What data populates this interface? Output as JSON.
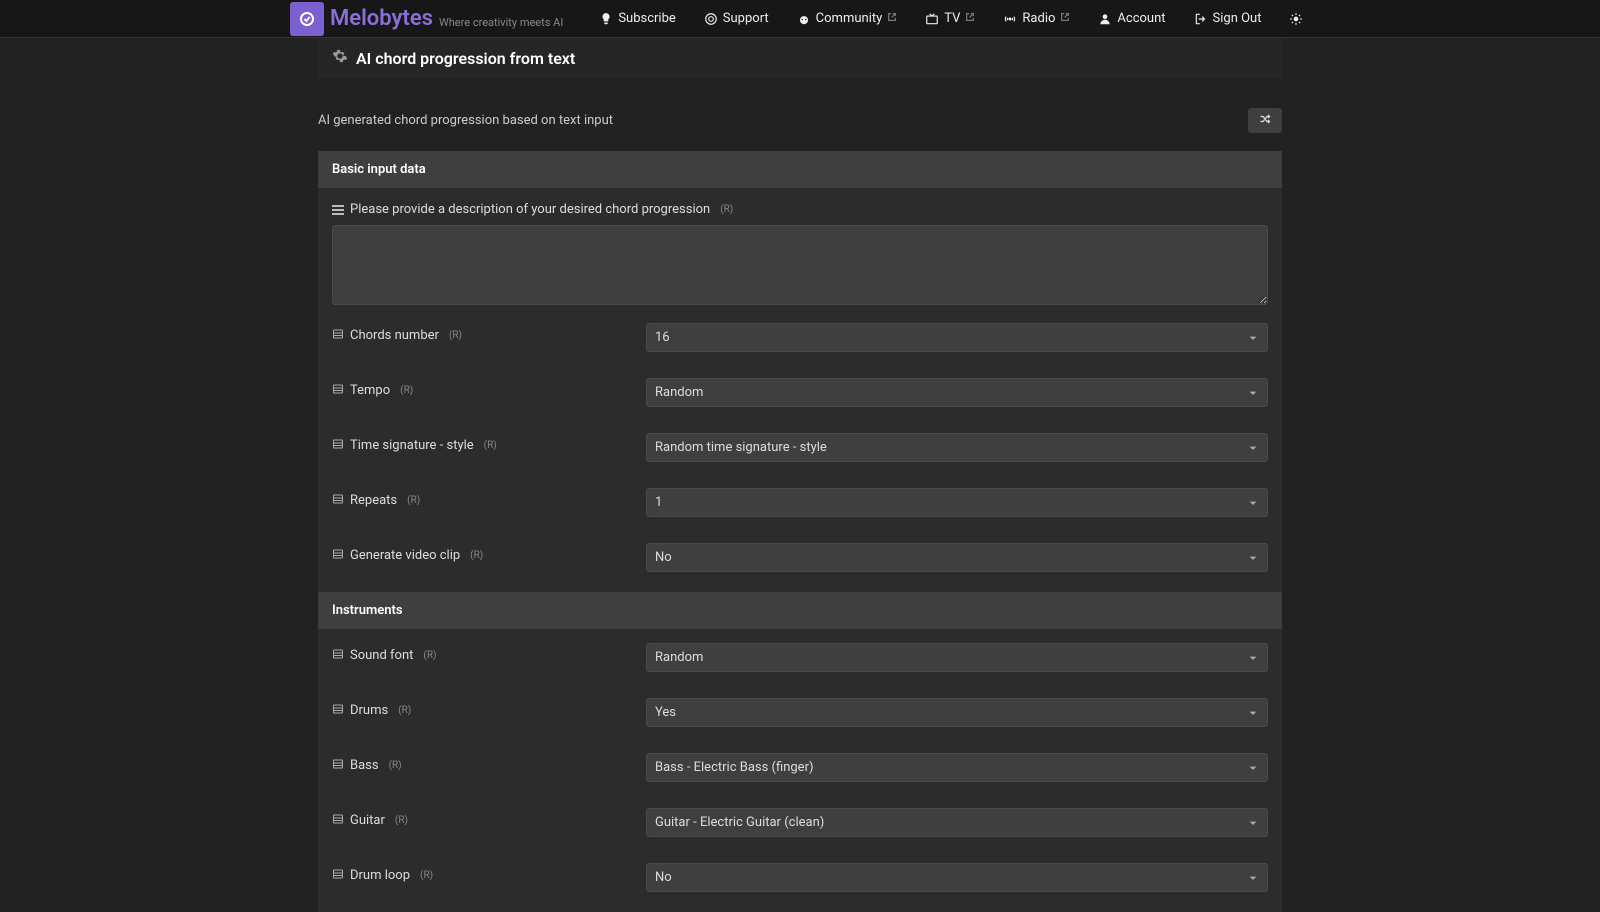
{
  "brand": {
    "name": "Melobytes",
    "tagline": "Where creativity meets AI"
  },
  "nav": {
    "subscribe": "Subscribe",
    "support": "Support",
    "community": "Community",
    "tv": "TV",
    "radio": "Radio",
    "account": "Account",
    "signout": "Sign Out"
  },
  "page": {
    "title": "AI chord progression from text",
    "description": "AI generated chord progression based on text input"
  },
  "sections": {
    "basic": "Basic input data",
    "instruments": "Instruments"
  },
  "labels": {
    "description": "Please provide a description of your desired chord progression",
    "chords_number": "Chords number",
    "tempo": "Tempo",
    "time_sig": "Time signature - style",
    "repeats": "Repeats",
    "gen_video": "Generate video clip",
    "sound_font": "Sound font",
    "drums": "Drums",
    "bass": "Bass",
    "guitar": "Guitar",
    "drum_loop": "Drum loop",
    "req": "(R)"
  },
  "values": {
    "description": "",
    "chords_number": "16",
    "tempo": "Random",
    "time_sig": "Random time signature - style",
    "repeats": "1",
    "gen_video": "No",
    "sound_font": "Random",
    "drums": "Yes",
    "bass": "Bass - Electric Bass (finger)",
    "guitar": "Guitar - Electric Guitar (clean)",
    "drum_loop": "No"
  }
}
